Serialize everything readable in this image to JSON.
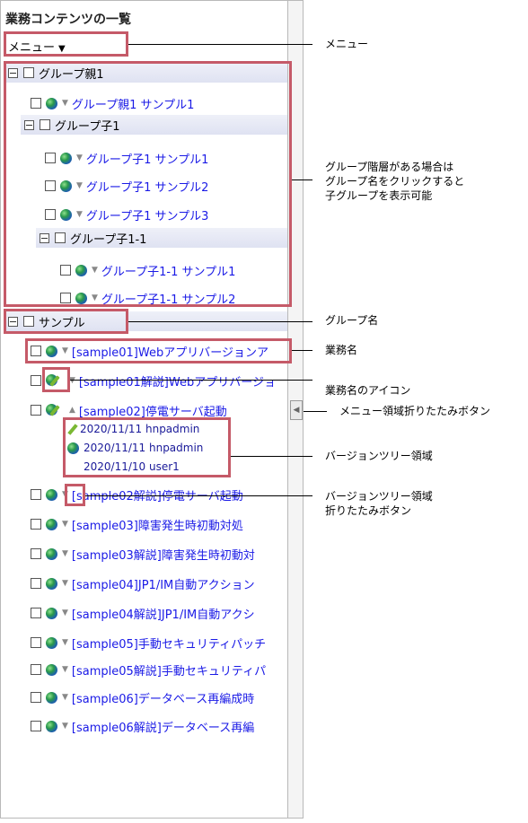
{
  "panel": {
    "title": "業務コンテンツの一覧",
    "menu_label": "メニュー",
    "menu_arrow": "▼"
  },
  "tree": {
    "group_parent": "グループ親1",
    "parent_sample1": "グループ親1 サンプル1",
    "group_child": "グループ子1",
    "child_sample1": "グループ子1 サンプル1",
    "child_sample2": "グループ子1 サンプル2",
    "child_sample3": "グループ子1 サンプル3",
    "group_child_1_1": "グループ子1-1",
    "child11_sample1": "グループ子1-1 サンプル1",
    "child11_sample2": "グループ子1-1 サンプル2",
    "group_sample": "サンプル",
    "items": [
      "[sample01]Webアプリバージョンア",
      "[sample01解説]Webアプリバージョ",
      "[sample02]停電サーバ起動",
      "[sample02解説]停電サーバ起動",
      "[sample03]障害発生時初動対処",
      "[sample03解説]障害発生時初動対",
      "[sample04]JP1/IM自動アクション",
      "[sample04解説]JP1/IM自動アクシ",
      "[sample05]手動セキュリティパッチ",
      "[sample05解説]手動セキュリティパ",
      "[sample06]データベース再編成時",
      "[sample06解説]データベース再編"
    ],
    "versions": [
      "2020/11/11 hnpadmin",
      "2020/11/11 hnpadmin",
      "2020/11/10 user1"
    ]
  },
  "callouts": {
    "menu": "メニュー",
    "group_hierarchy": "グループ階層がある場合は\nグループ名をクリックすると\n子グループを表示可能",
    "group_name": "グループ名",
    "business_name": "業務名",
    "business_icon": "業務名のアイコン",
    "collapse_menu": "メニュー領域折りたたみボタン",
    "version_tree": "バージョンツリー領域",
    "version_tree_collapse": "バージョンツリー領域\n折りたたみボタン"
  },
  "colors": {
    "highlight_box": "#c55a68",
    "link": "#1a1ae6",
    "group_bg": "#dfe2f2"
  },
  "icons": [
    "expander-minus-icon",
    "checkbox-icon",
    "globe-icon",
    "pencil-icon",
    "chevron-down-icon",
    "chevron-up-icon",
    "arrow-left-icon"
  ]
}
